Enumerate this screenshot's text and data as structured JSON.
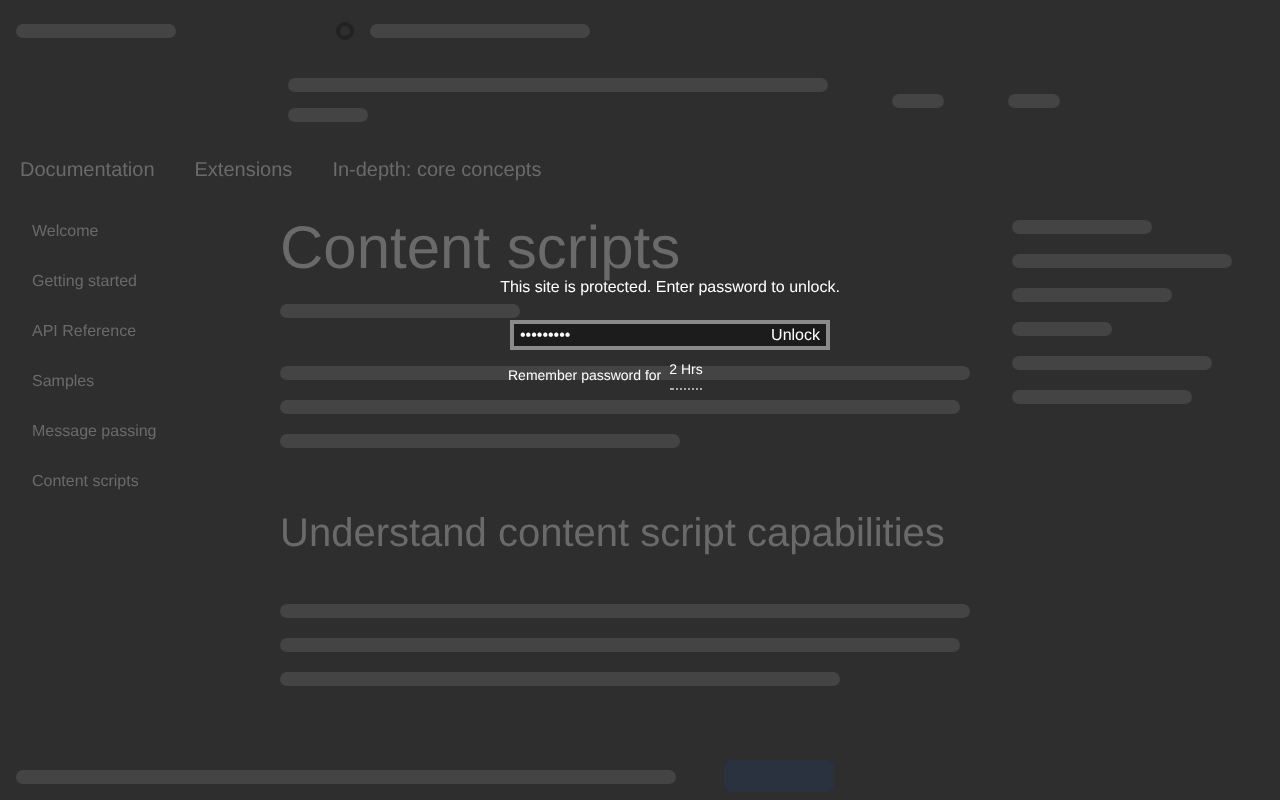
{
  "breadcrumbs": [
    {
      "label": "Documentation"
    },
    {
      "label": "Extensions"
    },
    {
      "label": "In-depth: core concepts"
    }
  ],
  "sidebar": {
    "items": [
      {
        "label": "Welcome"
      },
      {
        "label": "Getting started"
      },
      {
        "label": "API Reference"
      },
      {
        "label": "Samples"
      },
      {
        "label": "Message passing"
      },
      {
        "label": "Content scripts"
      }
    ]
  },
  "article": {
    "title": "Content scripts",
    "section_heading": "Understand content script capabilities"
  },
  "lock_dialog": {
    "message": "This site is protected. Enter password to unlock.",
    "password": {
      "value": "•••••••••"
    },
    "unlock_button": "Unlock",
    "remember_label": "Remember password for",
    "remember_duration": "2 Hrs"
  }
}
